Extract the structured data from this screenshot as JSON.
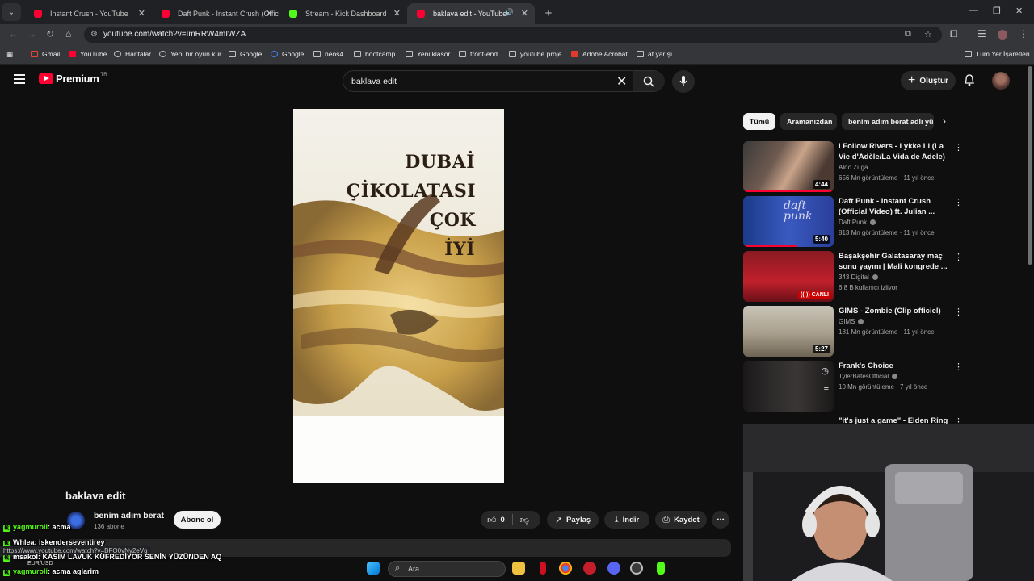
{
  "browser": {
    "tabs": [
      {
        "title": "Instant Crush - YouTube",
        "favicon_color": "#ff0033"
      },
      {
        "title": "Daft Punk - Instant Crush (Offic",
        "favicon_color": "#ff0033"
      },
      {
        "title": "Stream - Kick Dashboard",
        "favicon_color": "#53fc18"
      },
      {
        "title": "baklava edit - YouTube",
        "favicon_color": "#ff0033",
        "active": true
      }
    ],
    "url": "youtube.com/watch?v=ImRRW4mIWZA",
    "bookmarks": [
      "Gmail",
      "YouTube",
      "Haritalar",
      "Yeni bir oyun kur",
      "Google",
      "Google",
      "neos4",
      "bootcamp",
      "Yeni klasör",
      "front-end",
      "youtube proje",
      "Adobe Acrobat",
      "at yarışı"
    ],
    "bookmarks_right": "Tüm Yer İşaretleri"
  },
  "youtube": {
    "logo_word": "Premium",
    "logo_country": "TR",
    "search_query": "baklava edit",
    "create_label": "Oluştur",
    "video": {
      "overlay_lines": [
        "DUBAİ",
        "ÇİKOLATASI ÇOK",
        "İYİ"
      ],
      "title": "baklava edit",
      "channel": "benim adım berat",
      "subscribers": "136 abone",
      "subscribe_label": "Abone ol",
      "likes": "0",
      "share_label": "Paylaş",
      "download_label": "İndir",
      "save_label": "Kaydet"
    },
    "chips": [
      "Tümü",
      "Aramanızdan",
      "benim adım berat adlı yü"
    ],
    "recommendations": [
      {
        "title": "I Follow Rivers - Lykke Li (La Vie d'Adèle/La Vida de Adele)",
        "channel": "Aldo Zuga",
        "meta": "656 Mn görüntüleme · 11 yıl önce",
        "duration": "4:44",
        "verified": false,
        "progress": 1.0
      },
      {
        "title": "Daft Punk - Instant Crush (Official Video) ft. Julian ...",
        "channel": "Daft Punk",
        "meta": "813 Mn görüntüleme · 11 yıl önce",
        "duration": "5:40",
        "verified": true,
        "progress": 0.6
      },
      {
        "title": "Başakşehir Galatasaray maç sonu yayını | Mali kongrede ...",
        "channel": "343 Digital",
        "meta": "6,8 B kullanıcı izliyor",
        "duration": "",
        "live_label": "((·)) CANLI",
        "verified": true
      },
      {
        "title": "GIMS - Zombie (Clip officiel)",
        "channel": "GIMS",
        "meta": "181 Mn görüntüleme · 11 yıl önce",
        "duration": "5:27",
        "verified": true
      },
      {
        "title": "Frank's Choice",
        "channel": "TylerBatesOfficial",
        "meta": "10 Mn görüntüleme · 7 yıl önce",
        "duration": "",
        "verified": true
      },
      {
        "title": "\"it's just a game\" - Elden Ring",
        "channel": "",
        "meta": "",
        "duration": "",
        "verified": false
      }
    ]
  },
  "chat": [
    {
      "user": "yagmuroli",
      "message": ": acma"
    },
    {
      "user": "Whlea",
      "message": ": iskenderseventirey"
    },
    {
      "user": "msakol",
      "message": ": KASIM LAVUK KÜFREDİYOR SENİN YÜZÜNDEN AQ"
    },
    {
      "user": "yagmuroli",
      "message": ": acma aglarim"
    }
  ],
  "status_url": "https://www.youtube.com/watch?v=BFO0vNy2eVg",
  "ticker": "EUR/USD",
  "taskbar": {
    "search_label": "Ara"
  }
}
